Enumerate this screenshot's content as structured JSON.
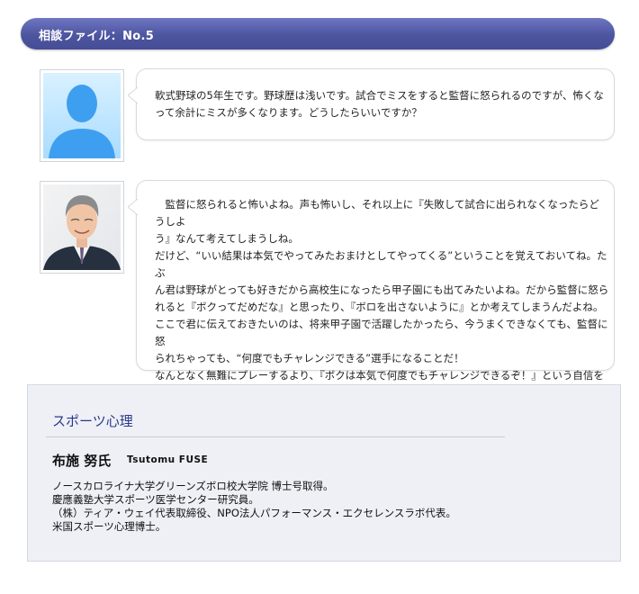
{
  "header": {
    "title": "相談ファイル：No.5"
  },
  "question": {
    "avatar_icon": "person-silhouette-icon",
    "text": "軟式野球の5年生です。野球歴は浅いです。試合でミスをすると監督に怒られるのですが、怖くな\nって余計にミスが多くなります。どうしたらいいですか？"
  },
  "answer": {
    "avatar_icon": "advisor-photo-icon",
    "text": "　監督に怒られると怖いよね。声も怖いし、それ以上に『失敗して試合に出られなくなったらどうしよ\nう』なんて考えてしまうしね。\nだけど、“いい結果は本気でやってみたおまけとしてやってくる”ということを覚えておいてね。たぶ\nん君は野球がとっても好きだから高校生になったら甲子園にも出てみたいよね。だから監督に怒ら\nれると『ボクってだめだな』と思ったり、『ボロを出さないように』とか考えてしまうんだよね。\nここで君に伝えておきたいのは、将来甲子園で活躍したかったら、今うまくできなくても、監督に怒\nられちゃっても、“何度でもチャレンジできる”選手になることだ！\nなんとなく無難にプレーするより、『ボクは本気で何度でもチャレンジできるぞ！』という自信をつけ\nることが小学生では大切です。"
  },
  "profile": {
    "category": "スポーツ心理",
    "name": "布施 努氏",
    "romaji": "Tsutomu FUSE",
    "bio": [
      "ノースカロライナ大学グリーンズボロ校大学院 博士号取得。",
      "慶應義塾大学スポーツ医学センター研究員。",
      "（株）ティア・ウェイ代表取締役、NPO法人パフォーマンス・エクセレンスラボ代表。",
      "米国スポーツ心理博士。"
    ]
  },
  "colors": {
    "header_bar": "#4d559f",
    "category_text": "#2b3788",
    "profile_bg": "#eef0f6"
  }
}
